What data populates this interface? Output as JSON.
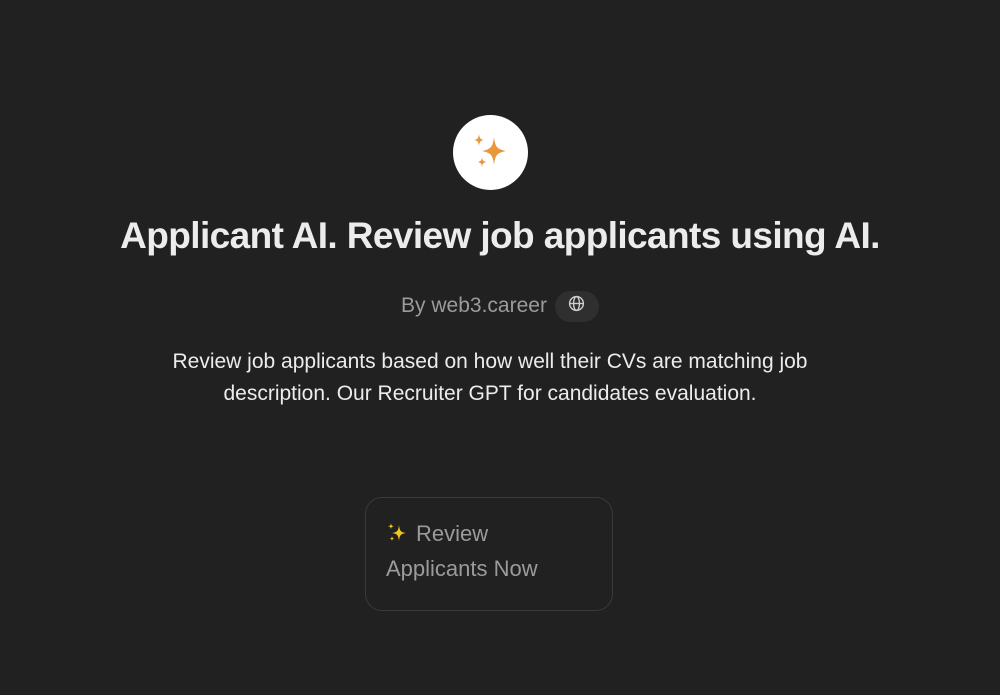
{
  "gpt": {
    "avatar_icon": "sparkles-icon",
    "title": "Applicant AI. Review job applicants using AI.",
    "author": "By web3.career",
    "website_icon": "globe-icon",
    "description": "Review job applicants based on how well their CVs are matching job description. Our Recruiter GPT for candidates evaluation."
  },
  "starters": [
    {
      "icon": "sparkles-emoji",
      "label": "Review Applicants Now"
    }
  ],
  "colors": {
    "background": "#212121",
    "accent_sparkle": "#E8973A",
    "text_primary": "#ECECEC",
    "text_secondary": "#9B9B9B"
  }
}
